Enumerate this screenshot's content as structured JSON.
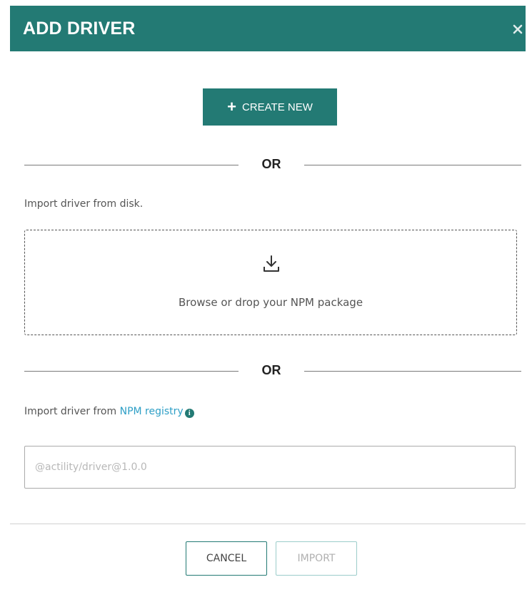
{
  "dialog": {
    "title": "ADD DRIVER",
    "close_icon": "close-icon",
    "create_button": {
      "icon": "plus-icon",
      "label": "CREATE NEW"
    },
    "divider_text": "OR",
    "disk_import": {
      "label": "Import driver from disk.",
      "dropzone_icon": "download-icon",
      "dropzone_text": "Browse or drop your NPM package"
    },
    "registry_import": {
      "label_prefix": "Import driver from",
      "link_text": "NPM registry",
      "info_icon": "info-icon",
      "input_value": "",
      "input_placeholder": "@actility/driver@1.0.0"
    },
    "footer": {
      "cancel_label": "CANCEL",
      "import_label": "IMPORT"
    }
  },
  "colors": {
    "accent": "#237a74",
    "link": "#2e9fc6",
    "disabled_text": "#b0b0b0"
  }
}
